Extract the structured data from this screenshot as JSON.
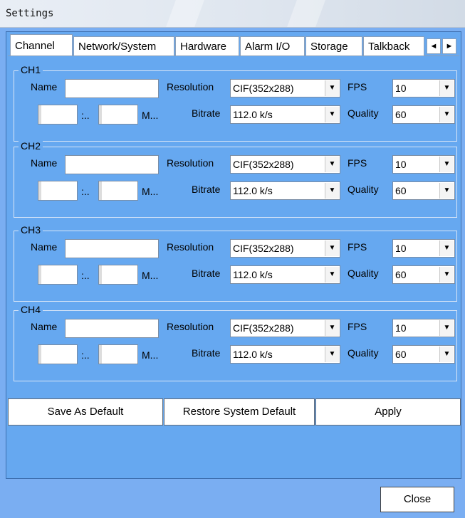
{
  "window": {
    "title": "Settings"
  },
  "tabs": [
    "Channel",
    "Network/System",
    "Hardware",
    "Alarm I/O",
    "Storage",
    "Talkback"
  ],
  "tab_scroll": {
    "left": "◄",
    "right": "►"
  },
  "labels": {
    "name": "Name",
    "resolution": "Resolution",
    "fps": "FPS",
    "bitrate": "Bitrate",
    "quality": "Quality",
    "mini_a_suffix": ":..",
    "mini_b_suffix": "M..."
  },
  "channels": [
    {
      "title": "CH1",
      "name": "",
      "resolution": "CIF(352x288)",
      "fps": "10",
      "bitrate": "112.0 k/s",
      "quality": "60"
    },
    {
      "title": "CH2",
      "name": "",
      "resolution": "CIF(352x288)",
      "fps": "10",
      "bitrate": "112.0 k/s",
      "quality": "60"
    },
    {
      "title": "CH3",
      "name": "",
      "resolution": "CIF(352x288)",
      "fps": "10",
      "bitrate": "112.0 k/s",
      "quality": "60"
    },
    {
      "title": "CH4",
      "name": "",
      "resolution": "CIF(352x288)",
      "fps": "10",
      "bitrate": "112.0 k/s",
      "quality": "60"
    }
  ],
  "buttons": {
    "save_default": "Save As Default",
    "restore_default": "Restore System Default",
    "apply": "Apply",
    "close": "Close"
  },
  "icons": {
    "dropdown": "chevron-down-icon",
    "scroll_left": "arrow-left-icon",
    "scroll_right": "arrow-right-icon"
  },
  "colors": {
    "background": "#7aaef2",
    "panel": "#66a8f0"
  }
}
